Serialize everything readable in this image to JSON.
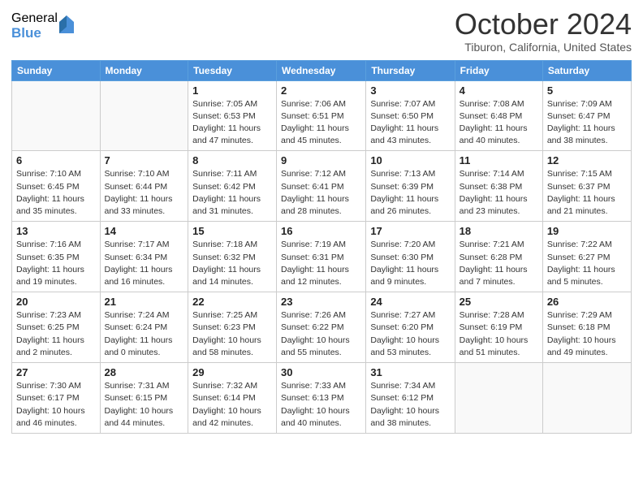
{
  "logo": {
    "general": "General",
    "blue": "Blue"
  },
  "header": {
    "month": "October 2024",
    "location": "Tiburon, California, United States"
  },
  "weekdays": [
    "Sunday",
    "Monday",
    "Tuesday",
    "Wednesday",
    "Thursday",
    "Friday",
    "Saturday"
  ],
  "weeks": [
    [
      {
        "day": "",
        "info": ""
      },
      {
        "day": "",
        "info": ""
      },
      {
        "day": "1",
        "info": "Sunrise: 7:05 AM\nSunset: 6:53 PM\nDaylight: 11 hours and 47 minutes."
      },
      {
        "day": "2",
        "info": "Sunrise: 7:06 AM\nSunset: 6:51 PM\nDaylight: 11 hours and 45 minutes."
      },
      {
        "day": "3",
        "info": "Sunrise: 7:07 AM\nSunset: 6:50 PM\nDaylight: 11 hours and 43 minutes."
      },
      {
        "day": "4",
        "info": "Sunrise: 7:08 AM\nSunset: 6:48 PM\nDaylight: 11 hours and 40 minutes."
      },
      {
        "day": "5",
        "info": "Sunrise: 7:09 AM\nSunset: 6:47 PM\nDaylight: 11 hours and 38 minutes."
      }
    ],
    [
      {
        "day": "6",
        "info": "Sunrise: 7:10 AM\nSunset: 6:45 PM\nDaylight: 11 hours and 35 minutes."
      },
      {
        "day": "7",
        "info": "Sunrise: 7:10 AM\nSunset: 6:44 PM\nDaylight: 11 hours and 33 minutes."
      },
      {
        "day": "8",
        "info": "Sunrise: 7:11 AM\nSunset: 6:42 PM\nDaylight: 11 hours and 31 minutes."
      },
      {
        "day": "9",
        "info": "Sunrise: 7:12 AM\nSunset: 6:41 PM\nDaylight: 11 hours and 28 minutes."
      },
      {
        "day": "10",
        "info": "Sunrise: 7:13 AM\nSunset: 6:39 PM\nDaylight: 11 hours and 26 minutes."
      },
      {
        "day": "11",
        "info": "Sunrise: 7:14 AM\nSunset: 6:38 PM\nDaylight: 11 hours and 23 minutes."
      },
      {
        "day": "12",
        "info": "Sunrise: 7:15 AM\nSunset: 6:37 PM\nDaylight: 11 hours and 21 minutes."
      }
    ],
    [
      {
        "day": "13",
        "info": "Sunrise: 7:16 AM\nSunset: 6:35 PM\nDaylight: 11 hours and 19 minutes."
      },
      {
        "day": "14",
        "info": "Sunrise: 7:17 AM\nSunset: 6:34 PM\nDaylight: 11 hours and 16 minutes."
      },
      {
        "day": "15",
        "info": "Sunrise: 7:18 AM\nSunset: 6:32 PM\nDaylight: 11 hours and 14 minutes."
      },
      {
        "day": "16",
        "info": "Sunrise: 7:19 AM\nSunset: 6:31 PM\nDaylight: 11 hours and 12 minutes."
      },
      {
        "day": "17",
        "info": "Sunrise: 7:20 AM\nSunset: 6:30 PM\nDaylight: 11 hours and 9 minutes."
      },
      {
        "day": "18",
        "info": "Sunrise: 7:21 AM\nSunset: 6:28 PM\nDaylight: 11 hours and 7 minutes."
      },
      {
        "day": "19",
        "info": "Sunrise: 7:22 AM\nSunset: 6:27 PM\nDaylight: 11 hours and 5 minutes."
      }
    ],
    [
      {
        "day": "20",
        "info": "Sunrise: 7:23 AM\nSunset: 6:25 PM\nDaylight: 11 hours and 2 minutes."
      },
      {
        "day": "21",
        "info": "Sunrise: 7:24 AM\nSunset: 6:24 PM\nDaylight: 11 hours and 0 minutes."
      },
      {
        "day": "22",
        "info": "Sunrise: 7:25 AM\nSunset: 6:23 PM\nDaylight: 10 hours and 58 minutes."
      },
      {
        "day": "23",
        "info": "Sunrise: 7:26 AM\nSunset: 6:22 PM\nDaylight: 10 hours and 55 minutes."
      },
      {
        "day": "24",
        "info": "Sunrise: 7:27 AM\nSunset: 6:20 PM\nDaylight: 10 hours and 53 minutes."
      },
      {
        "day": "25",
        "info": "Sunrise: 7:28 AM\nSunset: 6:19 PM\nDaylight: 10 hours and 51 minutes."
      },
      {
        "day": "26",
        "info": "Sunrise: 7:29 AM\nSunset: 6:18 PM\nDaylight: 10 hours and 49 minutes."
      }
    ],
    [
      {
        "day": "27",
        "info": "Sunrise: 7:30 AM\nSunset: 6:17 PM\nDaylight: 10 hours and 46 minutes."
      },
      {
        "day": "28",
        "info": "Sunrise: 7:31 AM\nSunset: 6:15 PM\nDaylight: 10 hours and 44 minutes."
      },
      {
        "day": "29",
        "info": "Sunrise: 7:32 AM\nSunset: 6:14 PM\nDaylight: 10 hours and 42 minutes."
      },
      {
        "day": "30",
        "info": "Sunrise: 7:33 AM\nSunset: 6:13 PM\nDaylight: 10 hours and 40 minutes."
      },
      {
        "day": "31",
        "info": "Sunrise: 7:34 AM\nSunset: 6:12 PM\nDaylight: 10 hours and 38 minutes."
      },
      {
        "day": "",
        "info": ""
      },
      {
        "day": "",
        "info": ""
      }
    ]
  ]
}
